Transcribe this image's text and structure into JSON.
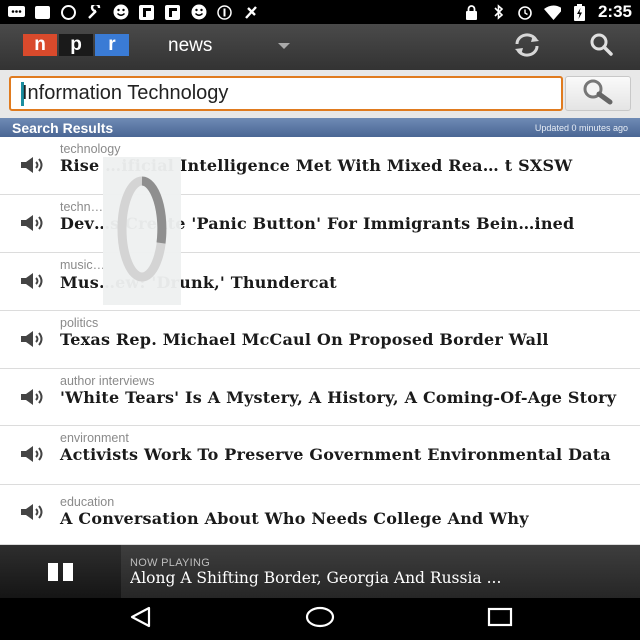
{
  "status_bar": {
    "time": "2:35",
    "left_icons": [
      "message-icon",
      "square-icon",
      "alarm-icon",
      "wrench-icon",
      "smiley-icon",
      "flipboard-icon",
      "flipboard-icon",
      "smiley-icon",
      "currency-icon",
      "data-saver-icon"
    ],
    "right_icons": [
      "lock-icon",
      "bluetooth-icon",
      "alarm-icon",
      "wifi-icon",
      "battery-charging-icon"
    ]
  },
  "app_bar": {
    "logo_letters": [
      "n",
      "p",
      "r"
    ],
    "logo_colors": [
      "#d94a2c",
      "#1a1a1a",
      "#3a7bd5"
    ],
    "section_title": "news",
    "refresh_icon": "refresh-icon",
    "search_icon": "search-icon"
  },
  "search": {
    "query": "Information Technology",
    "button_icon": "magnifier-icon"
  },
  "results_header": {
    "title": "Search Results",
    "updated": "Updated 0 minutes ago"
  },
  "results": [
    {
      "category": "technology",
      "headline": "Rise …ificial Intelligence Met With Mixed Rea… t SXSW"
    },
    {
      "category": "techn…",
      "headline": "Dev…s Create 'Panic Button' For Immigrants Bein…ined"
    },
    {
      "category": "music…",
      "headline": "Mus…ew: 'Drunk,' Thundercat"
    },
    {
      "category": "politics",
      "headline": "Texas Rep. Michael McCaul On Proposed Border Wall"
    },
    {
      "category": "author interviews",
      "headline": "'White Tears' Is A Mystery, A History, A Coming-Of-Age Story"
    },
    {
      "category": "environment",
      "headline": "Activists Work To Preserve Government Environmental Data"
    },
    {
      "category": "education",
      "headline": "A Conversation About Who Needs College And Why"
    }
  ],
  "now_playing": {
    "label": "NOW PLAYING",
    "title": "Along A Shifting Border, Georgia And Russia ..."
  },
  "nav_bar": {
    "back_icon": "back-triangle-icon",
    "home_icon": "home-circle-icon",
    "recents_icon": "recents-square-icon"
  }
}
